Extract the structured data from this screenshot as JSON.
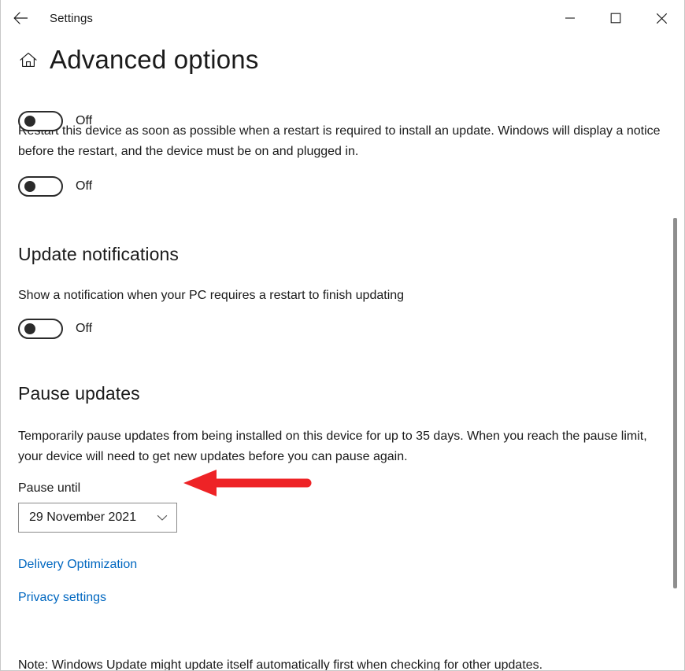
{
  "titlebar": {
    "back_icon": "back-arrow-icon",
    "app_title": "Settings",
    "minimize_label": "Minimize",
    "maximize_label": "Maximize",
    "close_label": "Close"
  },
  "header": {
    "home_icon": "home-icon",
    "title": "Advanced options"
  },
  "restart_section": {
    "clipped_toggle_label": "Off",
    "description": "Restart this device as soon as possible when a restart is required to install an update. Windows will display a notice before the restart, and the device must be on and plugged in.",
    "toggle_label": "Off",
    "toggle_state": "off"
  },
  "update_notifications": {
    "heading": "Update notifications",
    "description": "Show a notification when your PC requires a restart to finish updating",
    "toggle_label": "Off",
    "toggle_state": "off"
  },
  "pause_updates": {
    "heading": "Pause updates",
    "description": "Temporarily pause updates from being installed on this device for up to 35 days. When you reach the pause limit, your device will need to get new updates before you can pause again.",
    "field_label": "Pause until",
    "selected_value": "29 November 2021",
    "chevron_icon": "chevron-down-icon"
  },
  "links": [
    {
      "label": "Delivery Optimization"
    },
    {
      "label": "Privacy settings"
    }
  ],
  "footer": {
    "note": "Note: Windows Update might update itself automatically first when checking for other updates."
  },
  "annotation": {
    "arrow_icon": "left-arrow-annotation",
    "color": "#ee2326"
  },
  "colors": {
    "link": "#0067c0",
    "text": "#1a1a1a",
    "border": "#8a8a8a",
    "scrollbar": "#8e8e8e"
  }
}
